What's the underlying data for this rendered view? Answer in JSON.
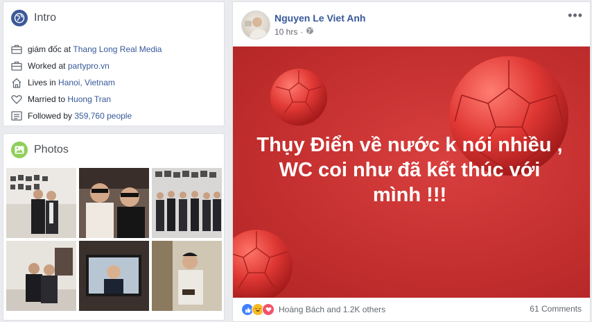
{
  "intro": {
    "title": "Intro",
    "icon": "globe-icon",
    "items": [
      {
        "icon": "briefcase-icon",
        "prefix": "giám đốc at",
        "link": "Thang Long Real Media",
        "suffix": ""
      },
      {
        "icon": "briefcase-icon",
        "prefix": "Worked at",
        "link": "partypro.vn",
        "suffix": ""
      },
      {
        "icon": "home-icon",
        "prefix": "Lives in",
        "link": "Hanoi, Vietnam",
        "suffix": ""
      },
      {
        "icon": "heart-icon",
        "prefix": "Married to",
        "link": "Huong Tran",
        "suffix": ""
      },
      {
        "icon": "followers-icon",
        "prefix": "Followed by",
        "link": "359,760",
        "suffix": "people"
      }
    ]
  },
  "photos": {
    "title": "Photos",
    "icon": "photo-icon"
  },
  "post": {
    "author": "Nguyen Le Viet Anh",
    "time": "10 hrs",
    "privacy_icon": "globe-icon",
    "banner_text": "Thụy Điển về nước k nói nhiều , WC coi như đã kết thúc với mình !!!",
    "reactions_text": "Hoàng Bách and 1.2K others",
    "comments": "61 Comments"
  },
  "colors": {
    "link": "#365899",
    "banner": "#c42f2f",
    "page_bg": "#e9ebee"
  }
}
